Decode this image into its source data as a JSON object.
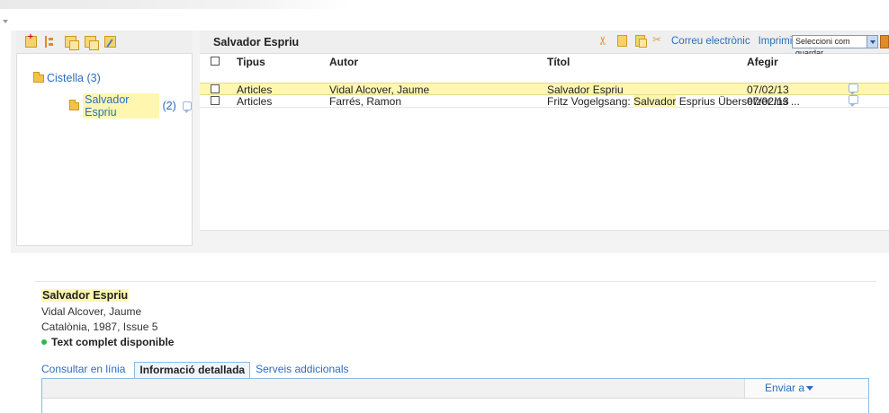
{
  "folders": {
    "root_label": "Cistella (3)",
    "child_label": "Salvador Espriu",
    "child_count": "(2)"
  },
  "toolbar": {
    "left_icons": [
      "new-folder-icon",
      "add-subfolder-icon",
      "tree-icon",
      "copy-folder-icon",
      "edit-folder-icon"
    ]
  },
  "results": {
    "folder_title": "Salvador Espriu",
    "email_link": "Correu electrònic",
    "print_link": "Imprimir",
    "save_select_value": "Seleccioni com guardar",
    "columns": {
      "tipus": "Tipus",
      "autor": "Autor",
      "titol": "Títol",
      "afegir": "Afegir"
    },
    "rows": [
      {
        "tipus": "Articles",
        "autor": "Vidal Alcover, Jaume",
        "titol": "Salvador Espriu",
        "afegir": "07/02/13"
      },
      {
        "tipus": "Articles",
        "autor": "Farrés, Ramon",
        "titol_pre": "Fritz Vogelgsang: ",
        "titol_kw": "Salvador",
        "titol_post": " Esprius Übersetzer ins ...",
        "afegir": "07/02/13"
      }
    ]
  },
  "detail": {
    "title": "Salvador Espriu",
    "author": "Vidal Alcover, Jaume",
    "source": "Catalònia, 1987, Issue 5",
    "availability": "Text complet disponible",
    "tabs": [
      "Consultar en línia",
      "Informació detallada",
      "Serveis addicionals"
    ],
    "send_to": "Enviar a"
  },
  "colors": {
    "highlight": "#fff7b0",
    "link": "#2a6dbf",
    "available": "#2db84a",
    "accent_orange": "#e08a2a"
  }
}
